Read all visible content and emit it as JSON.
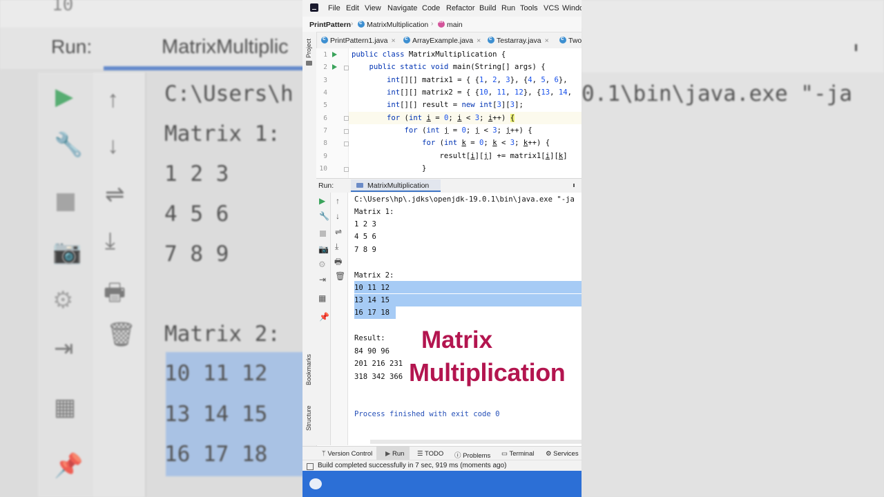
{
  "background": {
    "run_label": "Run:",
    "tab_label": "MatrixMultiplic",
    "path_text": "C:\\Users\\h",
    "right_text": "0.1\\bin\\java.exe \"-ja",
    "lines": [
      "Matrix 1:",
      "1 2 3",
      "4 5 6",
      "7 8 9",
      "Matrix 2:",
      "10 11 12",
      "13 14 15",
      "16 17 18"
    ],
    "top_partial": "10"
  },
  "menu": [
    "File",
    "Edit",
    "View",
    "Navigate",
    "Code",
    "Refactor",
    "Build",
    "Run",
    "Tools",
    "VCS",
    "Windo"
  ],
  "breadcrumb": {
    "project": "PrintPattern",
    "class": "MatrixMultiplication",
    "method": "main"
  },
  "tabs": [
    "PrintPattern1.java",
    "ArrayExample.java",
    "Testarray.java",
    "Two"
  ],
  "side_labels": {
    "project": "Project",
    "bookmarks": "Bookmarks",
    "structure": "Structure"
  },
  "line_numbers": [
    "1",
    "2",
    "3",
    "4",
    "5",
    "6",
    "7",
    "8",
    "9",
    "10"
  ],
  "run_panel": {
    "label": "Run:",
    "tab": "MatrixMultiplication"
  },
  "console": {
    "cmd": "C:\\Users\\hp\\.jdks\\openjdk-19.0.1\\bin\\java.exe \"-ja",
    "m1_title": "Matrix 1:",
    "m1": [
      "1 2 3",
      "4 5 6",
      "7 8 9"
    ],
    "m2_title": "Matrix 2:",
    "m2": [
      "10 11 12",
      "13 14 15",
      "16 17 18"
    ],
    "result_title": "Result:",
    "result": [
      "84 90 96",
      "201 216 231",
      "318 342 366"
    ],
    "exit": "Process finished with exit code 0"
  },
  "overlay": {
    "line1": "Matrix",
    "line2": "Multiplication"
  },
  "toolwindows": [
    "Version Control",
    "Run",
    "TODO",
    "Problems",
    "Terminal",
    "Services"
  ],
  "status": "Build completed successfully in 7 sec, 919 ms (moments ago)",
  "colors": {
    "keyword": "#0033b3",
    "number": "#1750eb",
    "overlay_text": "#b3154f",
    "selection": "#a6cbf5",
    "taskbar": "#2c6fd6"
  }
}
